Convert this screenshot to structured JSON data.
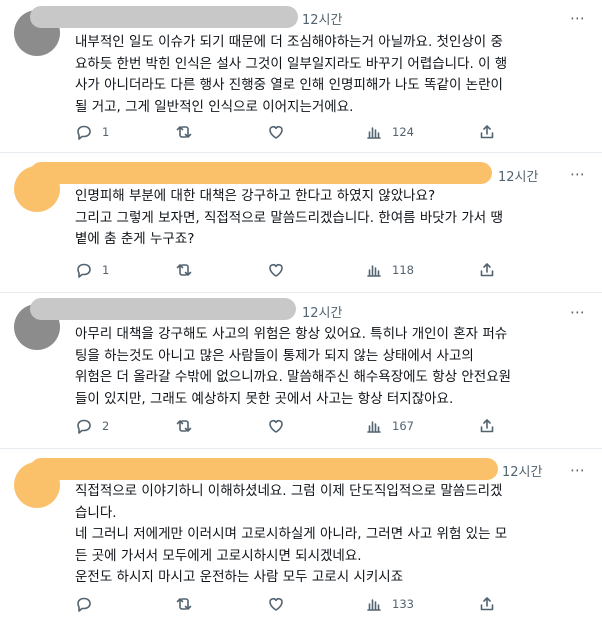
{
  "colors": {
    "accent_orange": "#fbc16a",
    "redaction_gray": "#8c8c8c",
    "text": "#0f1419",
    "muted": "#536471"
  },
  "icons": {
    "reply": "reply-icon",
    "retweet": "retweet-icon",
    "like": "like-icon",
    "views": "views-icon",
    "share": "share-icon",
    "more": "more-icon"
  },
  "tweets": [
    {
      "time": "12시간",
      "body": "내부적인 일도 이슈가 되기 때문에 더 조심해야하는거 아닐까요. 첫인상이 중\n요하듯 한번 박힌 인식은 설사 그것이 일부일지라도 바꾸기 어렵습니다. 이 행\n사가 아니더라도 다른 행사 진행중 열로 인해 인명피해가 나도 똑같이 논란이\n될 거고, 그게 일반적인 인식으로 이어지는거에요.",
      "replies": "1",
      "retweets": "",
      "likes": "",
      "views": "124"
    },
    {
      "time": "12시간",
      "body": "인명피해 부분에 대한 대책은 강구하고 한다고 하였지 않았나요?\n그리고 그렇게 보자면, 직접적으로 말씀드리겠습니다. 한여름 바닷가 가서 땡\n볕에 춤 춘게 누구죠?",
      "replies": "1",
      "retweets": "",
      "likes": "",
      "views": "118"
    },
    {
      "time": "12시간",
      "body": "아무리 대책을 강구해도 사고의 위험은 항상 있어요. 특히나 개인이 혼자 퍼슈\n팅을 하는것도 아니고 많은 사람들이 통제가 되지 않는 상태에서 사고의\n위험은 더 올라갈 수밖에 없으니까요. 말씀해주신 해수욕장에도 항상 안전요원\n들이 있지만, 그래도 예상하지 못한 곳에서 사고는 항상 터지잖아요.",
      "replies": "2",
      "retweets": "",
      "likes": "",
      "views": "167"
    },
    {
      "time": "12시간",
      "body": "직접적으로 이야기하니 이해하셨네요. 그럼 이제 단도직입적으로 말씀드리겠\n습니다.\n네 그러니 저에게만 이러시며 고로시하실게 아니라, 그러면 사고 위험 있는 모\n든 곳에 가서서 모두에게 고로시하시면 되시겠네요.\n운전도 하시지 마시고 운전하는 사람 모두 고로시 시키시죠",
      "replies": "",
      "retweets": "",
      "likes": "",
      "views": "133"
    }
  ]
}
